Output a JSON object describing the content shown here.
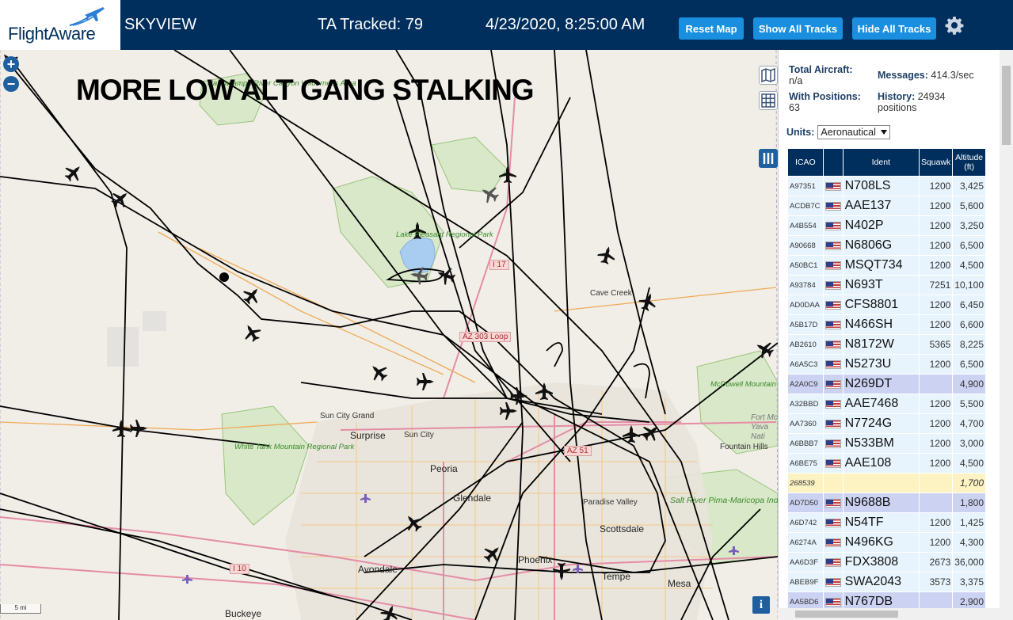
{
  "header": {
    "logo_text": "FlightAware",
    "site_name": "SKYVIEW",
    "ta_tracked": "TA Tracked: 79",
    "datetime": "4/23/2020, 8:25:00 AM",
    "buttons": {
      "reset_map": "Reset Map",
      "show_all": "Show All Tracks",
      "hide_all": "Hide All Tracks"
    }
  },
  "map": {
    "overlay_title": "MORE LOW ALT GANG STALKING",
    "zoom_in": "+",
    "zoom_out": "−",
    "info": "i",
    "scale_label": "5 mi",
    "labels": {
      "sun_city_grand": "Sun City Grand",
      "surprise": "Surprise",
      "sun_city": "Sun City",
      "peoria": "Peoria",
      "glendale": "Glendale",
      "phoenix": "Phoenix",
      "tempe": "Tempe",
      "mesa": "Mesa",
      "avondale": "Avondale",
      "buckeye": "Buckeye",
      "scottsdale": "Scottsdale",
      "paradise_valley": "Paradise Valley",
      "cave_creek": "Cave Creek",
      "fountain_hills": "Fountain Hills",
      "fort_mcdowell": "Fort Mc Yava Nati",
      "hassayampa": "Hassayampa River Canyon Wilderness Area",
      "lake_pleasant": "Lake Pleasant Regional Park",
      "white_tank": "White Tank Mountain Regional Park",
      "mcdowell": "McDowell Mountain Regional Park",
      "salt_river": "Salt River Pima-Maricopa Indian Community"
    },
    "highways": {
      "i17": "I 17",
      "az303": "AZ 303 Loop",
      "az51": "AZ 51",
      "i10": "I 10"
    }
  },
  "sidebar": {
    "total_aircraft_label": "Total Aircraft:",
    "total_aircraft_value": "n/a",
    "messages_label": "Messages:",
    "messages_value": "414.3/sec",
    "with_positions_label": "With Positions:",
    "with_positions_value": "63",
    "history_label": "History:",
    "history_value": "24934",
    "history_unit": "positions",
    "units_label": "Units:",
    "units_value": "Aeronautical",
    "columns": [
      "ICAO",
      "",
      "Ident",
      "Squawk",
      "Altitude (ft)"
    ],
    "rows": [
      {
        "icao": "A97351",
        "flag": true,
        "ident": "N708LS",
        "squawk": "1200",
        "alt": "3,425",
        "kind": "normal"
      },
      {
        "icao": "ACDB7C",
        "flag": true,
        "ident": "AAE137",
        "squawk": "1200",
        "alt": "5,600",
        "kind": "normal"
      },
      {
        "icao": "A4B554",
        "flag": true,
        "ident": "N402P",
        "squawk": "1200",
        "alt": "3,250",
        "kind": "normal"
      },
      {
        "icao": "A90668",
        "flag": true,
        "ident": "N6806G",
        "squawk": "1200",
        "alt": "6,500",
        "kind": "normal"
      },
      {
        "icao": "A50BC1",
        "flag": true,
        "ident": "MSQT734",
        "squawk": "1200",
        "alt": "4,500",
        "kind": "normal"
      },
      {
        "icao": "A93784",
        "flag": true,
        "ident": "N693T",
        "squawk": "7251",
        "alt": "10,100",
        "kind": "normal"
      },
      {
        "icao": "AD0DAA",
        "flag": true,
        "ident": "CFS8801",
        "squawk": "1200",
        "alt": "6,450",
        "kind": "normal"
      },
      {
        "icao": "A5B17D",
        "flag": true,
        "ident": "N466SH",
        "squawk": "1200",
        "alt": "6,600",
        "kind": "normal"
      },
      {
        "icao": "AB2610",
        "flag": true,
        "ident": "N8172W",
        "squawk": "5365",
        "alt": "8,225",
        "kind": "normal"
      },
      {
        "icao": "A6A5C3",
        "flag": true,
        "ident": "N5273U",
        "squawk": "1200",
        "alt": "6,500",
        "kind": "normal"
      },
      {
        "icao": "A2A0C9",
        "flag": true,
        "ident": "N269DT",
        "squawk": "",
        "alt": "4,900",
        "kind": "mlat"
      },
      {
        "icao": "A32BBD",
        "flag": true,
        "ident": "AAE7468",
        "squawk": "1200",
        "alt": "5,500",
        "kind": "normal"
      },
      {
        "icao": "AA7360",
        "flag": true,
        "ident": "N7724G",
        "squawk": "1200",
        "alt": "4,700",
        "kind": "normal"
      },
      {
        "icao": "A6BBB7",
        "flag": true,
        "ident": "N533BM",
        "squawk": "1200",
        "alt": "3,000",
        "kind": "normal"
      },
      {
        "icao": "A6BE75",
        "flag": true,
        "ident": "AAE108",
        "squawk": "1200",
        "alt": "4,500",
        "kind": "normal"
      },
      {
        "icao": "268539",
        "flag": false,
        "ident": "",
        "squawk": "",
        "alt": "1,700",
        "kind": "other"
      },
      {
        "icao": "AD7D50",
        "flag": true,
        "ident": "N9688B",
        "squawk": "",
        "alt": "1,800",
        "kind": "mlat"
      },
      {
        "icao": "A6D742",
        "flag": true,
        "ident": "N54TF",
        "squawk": "1200",
        "alt": "1,425",
        "kind": "normal"
      },
      {
        "icao": "A6274A",
        "flag": true,
        "ident": "N496KG",
        "squawk": "1200",
        "alt": "4,300",
        "kind": "normal"
      },
      {
        "icao": "AA6D3F",
        "flag": true,
        "ident": "FDX3808",
        "squawk": "2673",
        "alt": "36,000",
        "kind": "normal"
      },
      {
        "icao": "ABEB9F",
        "flag": true,
        "ident": "SWA2043",
        "squawk": "3573",
        "alt": "3,375",
        "kind": "normal"
      },
      {
        "icao": "AA5BD6",
        "flag": true,
        "ident": "N767DB",
        "squawk": "",
        "alt": "2,900",
        "kind": "mlat"
      }
    ]
  }
}
